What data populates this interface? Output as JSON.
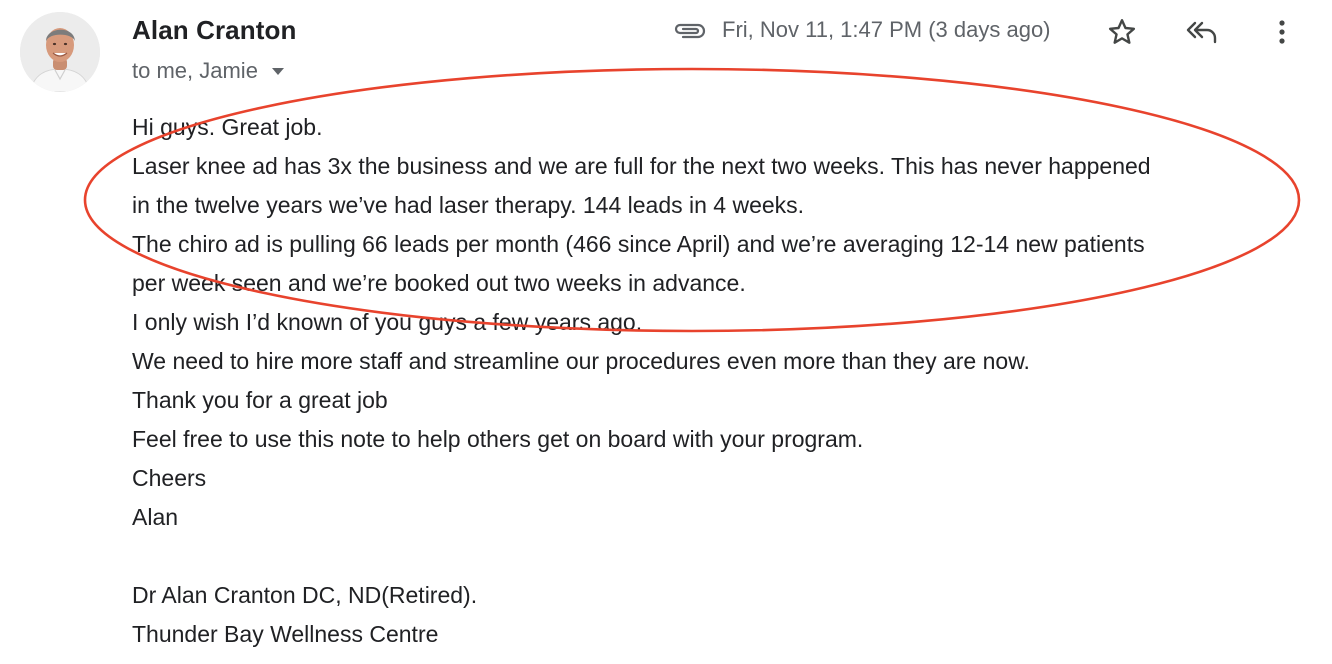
{
  "sender": {
    "name": "Alan Cranton",
    "recipients_label": "to me, Jamie",
    "avatar": "sender-photo"
  },
  "header": {
    "date": "Fri, Nov 11, 1:47 PM (3 days ago)",
    "icons": [
      "paperclip-icon",
      "star-icon",
      "reply-all-icon",
      "more-vert-icon"
    ]
  },
  "body": {
    "lines": [
      "Hi guys. Great job.",
      "Laser knee ad has 3x the business and we are full for the next two weeks. This has never happened",
      "in the twelve years we’ve had laser therapy. 144 leads in 4 weeks.",
      "The chiro ad is pulling 66 leads per month (466 since April) and we’re averaging 12-14 new patients",
      "per week seen and we’re booked out two weeks in advance.",
      "I only wish I’d known of you guys a few years ago.",
      "We need to hire more staff and streamline our procedures even more than they are now.",
      "Thank you for a great job",
      "Feel free to use this note to help others get on board with your program.",
      "Cheers",
      "Alan"
    ],
    "signature": [
      "Dr Alan Cranton DC, ND(Retired).",
      "Thunder Bay Wellness Centre"
    ]
  },
  "colors": {
    "text": "#202124",
    "secondary_text": "#5f6368",
    "annotation": "#e8432d"
  }
}
